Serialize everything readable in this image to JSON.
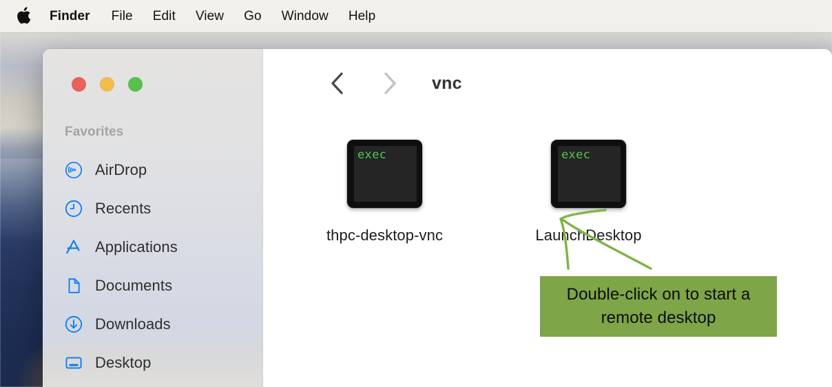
{
  "menubar": {
    "apple_icon": "apple-logo",
    "items": [
      {
        "label": "Finder",
        "bold": true
      },
      {
        "label": "File"
      },
      {
        "label": "Edit"
      },
      {
        "label": "View"
      },
      {
        "label": "Go"
      },
      {
        "label": "Window"
      },
      {
        "label": "Help"
      }
    ]
  },
  "window": {
    "traffic_lights": {
      "close_color": "#e8615a",
      "minimize_color": "#f3bd4d",
      "maximize_color": "#57c14b"
    },
    "toolbar": {
      "back_icon": "chevron-left-icon",
      "forward_icon": "chevron-right-icon",
      "title": "vnc"
    }
  },
  "sidebar": {
    "section_title": "Favorites",
    "items": [
      {
        "label": "AirDrop",
        "icon": "airdrop-icon"
      },
      {
        "label": "Recents",
        "icon": "clock-icon"
      },
      {
        "label": "Applications",
        "icon": "applications-icon"
      },
      {
        "label": "Documents",
        "icon": "document-icon"
      },
      {
        "label": "Downloads",
        "icon": "download-circle-icon"
      },
      {
        "label": "Desktop",
        "icon": "desktop-icon"
      }
    ],
    "accent_color": "#0a7cf5"
  },
  "files": [
    {
      "name": "thpc-desktop-vnc",
      "icon": "exec-file-icon",
      "icon_text": "exec"
    },
    {
      "name": "LaunchDesktop",
      "icon": "exec-file-icon",
      "icon_text": "exec"
    }
  ],
  "annotation": {
    "line1": "Double-click on to start a",
    "line2": "remote desktop",
    "box_color": "#7ea548",
    "arrow_color": "#7cb342",
    "arrow_icon": "hand-drawn-arrow-icon"
  }
}
